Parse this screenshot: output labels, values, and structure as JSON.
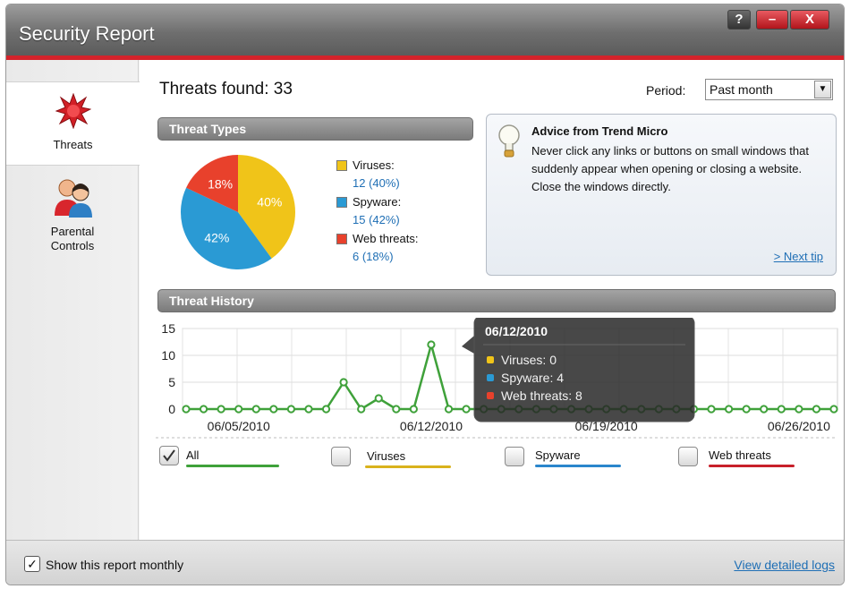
{
  "window": {
    "title": "Security Report",
    "help": "?",
    "minimize": "–",
    "close": "X"
  },
  "sidebar": {
    "items": [
      {
        "label": "Threats",
        "icon": "threat-burst-icon",
        "selected": true
      },
      {
        "label_line1": "Parental",
        "label_line2": "Controls",
        "icon": "parents-icon",
        "selected": false
      }
    ]
  },
  "summary": {
    "threats_found": "Threats found: 33"
  },
  "period": {
    "label": "Period:",
    "selected": "Past month"
  },
  "threat_types": {
    "header": "Threat Types",
    "legend": [
      {
        "name": "Viruses:",
        "value": "12 (40%)",
        "color": "#f0c419"
      },
      {
        "name": "Spyware:",
        "value": "15 (42%)",
        "color": "#2a9ad4"
      },
      {
        "name": "Web threats:",
        "value": "6 (18%)",
        "color": "#e8412c"
      }
    ]
  },
  "advice": {
    "title": "Advice from Trend Micro",
    "text": "Never click any links or buttons on small windows that suddenly appear when opening or closing a website. Close the windows directly.",
    "next": "> Next tip"
  },
  "threat_history": {
    "header": "Threat History",
    "tooltip": {
      "date": "06/12/2010",
      "lines": [
        "Viruses: 0",
        "Spyware: 4",
        "Web threats: 8"
      ],
      "colors": [
        "#f0c419",
        "#2a9ad4",
        "#e8412c"
      ]
    },
    "filters": [
      {
        "label": "All",
        "checked": true,
        "color": "#3fa13a"
      },
      {
        "label": "Viruses",
        "checked": false,
        "color": "#d9b21c"
      },
      {
        "label": "Spyware",
        "checked": false,
        "color": "#2a86cc"
      },
      {
        "label": "Web threats",
        "checked": false,
        "color": "#c8202a"
      }
    ]
  },
  "chart_data": [
    {
      "type": "pie",
      "title": "Threat Types",
      "slices": [
        {
          "name": "Viruses",
          "value": 40,
          "label": "40%",
          "color": "#f0c419"
        },
        {
          "name": "Spyware",
          "value": 42,
          "label": "42%",
          "color": "#2a9ad4"
        },
        {
          "name": "Web threats",
          "value": 18,
          "label": "18%",
          "color": "#e8412c"
        }
      ]
    },
    {
      "type": "line",
      "title": "Threat History",
      "x_ticks": [
        "06/05/2010",
        "06/12/2010",
        "06/19/2010",
        "06/26/2010"
      ],
      "y_ticks": [
        0,
        5,
        10,
        15
      ],
      "ylim": [
        0,
        15
      ],
      "grid": true,
      "series": [
        {
          "name": "All",
          "color": "#3fa13a",
          "values": [
            0,
            0,
            0,
            0,
            0,
            0,
            0,
            0,
            0,
            5,
            0,
            2,
            0,
            0,
            12,
            0,
            0,
            0,
            0,
            0,
            0,
            0,
            0,
            0,
            0,
            0,
            0,
            0,
            0,
            0,
            0,
            0,
            0,
            0,
            0,
            0,
            0,
            0
          ]
        }
      ]
    }
  ],
  "footer": {
    "show_monthly": "Show this report monthly",
    "view_logs": "View detailed logs"
  }
}
